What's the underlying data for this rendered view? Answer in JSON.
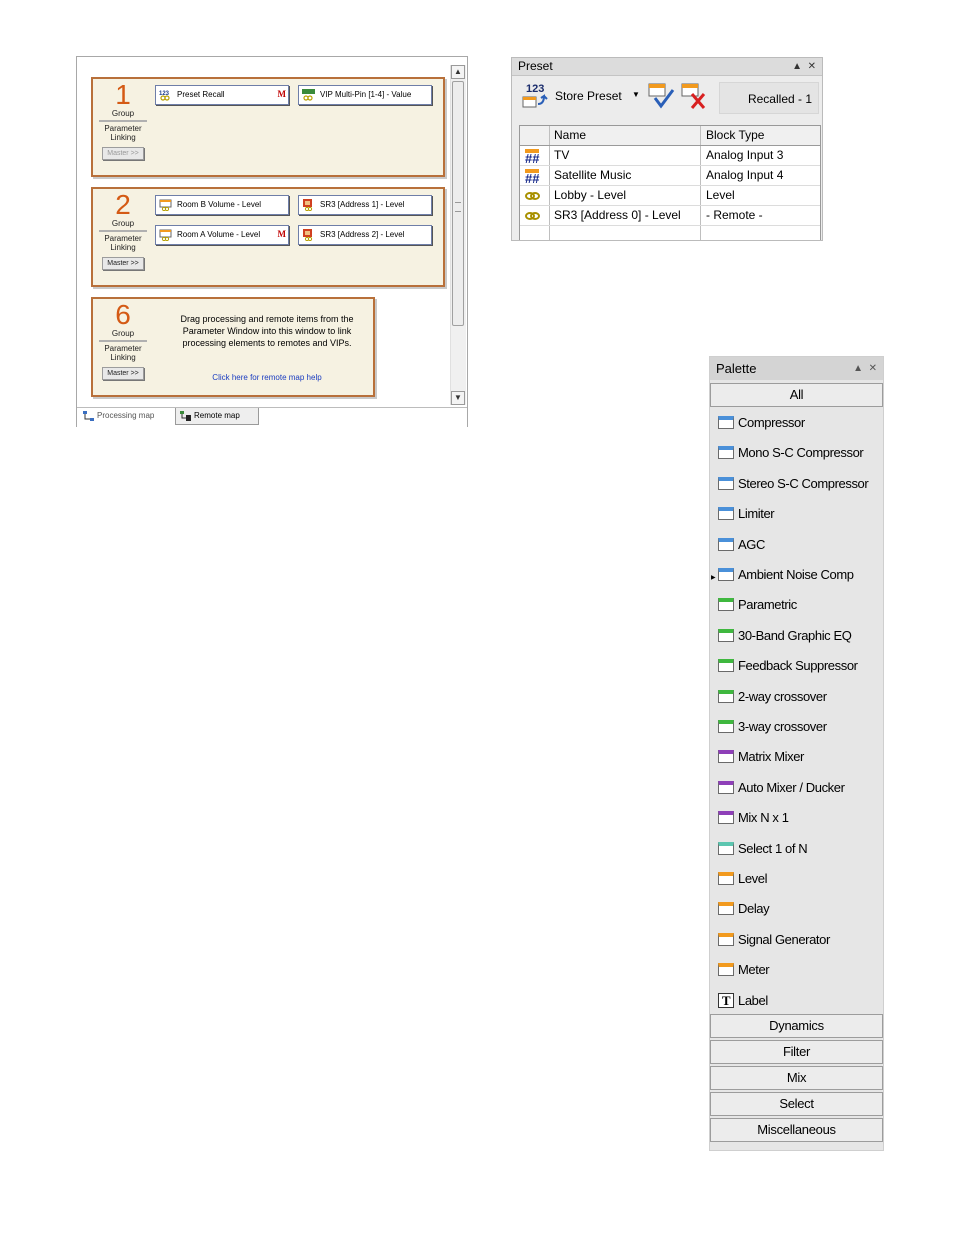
{
  "processing_map": {
    "groups": [
      {
        "number": "1",
        "group_label": "Group",
        "linking_label": "Parameter Linking",
        "master_label": "Master >>",
        "items": [
          {
            "label": "Preset Recall",
            "mark": "M"
          },
          {
            "label": "VIP Multi-Pin [1-4] - Value",
            "mark": ""
          }
        ]
      },
      {
        "number": "2",
        "group_label": "Group",
        "linking_label": "Parameter Linking",
        "master_label": "Master >>",
        "items": [
          {
            "label": "Room B Volume - Level",
            "mark": ""
          },
          {
            "label": "SR3 [Address 1] - Level",
            "mark": ""
          },
          {
            "label": "Room A Volume - Level",
            "mark": "M"
          },
          {
            "label": "SR3 [Address 2] - Level",
            "mark": ""
          }
        ]
      },
      {
        "number": "6",
        "group_label": "Group",
        "linking_label": "Parameter Linking",
        "master_label": "Master >>",
        "help_text": "Drag processing and remote items from the Parameter Window into this window to link processing elements to remotes and VIPs.",
        "help_link": "Click here for remote map help"
      }
    ],
    "tabs": [
      {
        "label": "Processing map"
      },
      {
        "label": "Remote map"
      }
    ]
  },
  "preset": {
    "title": "Preset",
    "store_label": "Store Preset",
    "recalled": "Recalled - 1",
    "columns": [
      "Name",
      "Block Type"
    ],
    "rows": [
      {
        "icon": "preset-grid-icon",
        "name": "TV",
        "block_type": "Analog Input 3"
      },
      {
        "icon": "preset-grid-icon",
        "name": "Satellite Music",
        "block_type": "Analog Input 4"
      },
      {
        "icon": "link-icon",
        "name": "Lobby - Level",
        "block_type": "Level"
      },
      {
        "icon": "link-icon",
        "name": "SR3 [Address 0] - Level",
        "block_type": "- Remote -"
      }
    ]
  },
  "palette": {
    "title": "Palette",
    "all_label": "All",
    "items": [
      {
        "label": "Compressor",
        "color": "#4a90d9"
      },
      {
        "label": "Mono S-C Compressor",
        "color": "#4a90d9"
      },
      {
        "label": "Stereo S-C Compressor",
        "color": "#4a90d9"
      },
      {
        "label": "Limiter",
        "color": "#4a90d9"
      },
      {
        "label": "AGC",
        "color": "#4a90d9"
      },
      {
        "label": "Ambient Noise Comp",
        "color": "#4a90d9"
      },
      {
        "label": "Parametric",
        "color": "#3fb83f"
      },
      {
        "label": "30-Band Graphic EQ",
        "color": "#3fb83f"
      },
      {
        "label": "Feedback Suppressor",
        "color": "#3fb83f"
      },
      {
        "label": "2-way crossover",
        "color": "#3fb83f"
      },
      {
        "label": "3-way crossover",
        "color": "#3fb83f"
      },
      {
        "label": "Matrix Mixer",
        "color": "#8e3fb8"
      },
      {
        "label": "Auto Mixer / Ducker",
        "color": "#8e3fb8"
      },
      {
        "label": "Mix N x 1",
        "color": "#8e3fb8"
      },
      {
        "label": "Select 1 of N",
        "color": "#5cc6b0"
      },
      {
        "label": "Level",
        "color": "#f29a1e"
      },
      {
        "label": "Delay",
        "color": "#f29a1e"
      },
      {
        "label": "Signal Generator",
        "color": "#f29a1e"
      },
      {
        "label": "Meter",
        "color": "#f29a1e"
      },
      {
        "label": "Label",
        "color": ""
      }
    ],
    "label_glyph": "T",
    "categories": [
      "Dynamics",
      "Filter",
      "Mix",
      "Select",
      "Miscellaneous"
    ]
  }
}
